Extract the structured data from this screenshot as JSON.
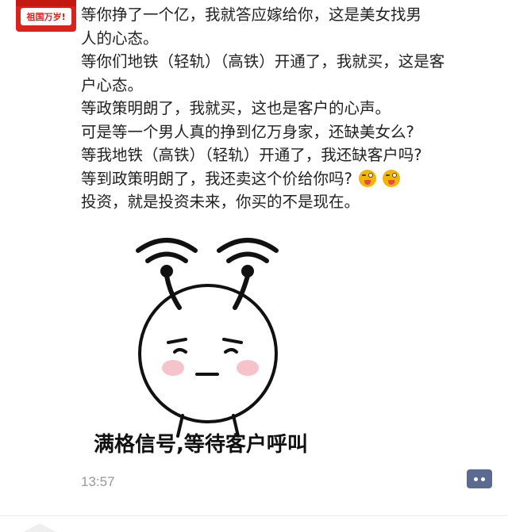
{
  "avatar": {
    "text": "祖国万岁!",
    "bg_color": "#d9241e"
  },
  "post": {
    "lines": [
      "等你挣了一个亿，我就答应嫁给你，这是美女找男",
      "人的心态。",
      "等你们地铁（轻轨）（高铁）开通了，我就买，这是客",
      "户心态。",
      "等政策明朗了，我就买，这也是客户的心声。",
      "可是等一个男人真的挣到亿万身家，还缺美女么?",
      "等我地铁（高铁）（轻轨）开通了，我还缺客户吗?",
      "等到政策明朗了，我还卖这个价给你吗?",
      "投资，就是投资未来，你买的不是现在。"
    ],
    "emoji_icon": "tongue-wink-emoji-icon"
  },
  "meme": {
    "caption": "满格信号,等待客户呼叫",
    "icon": "wifi-antenna-face-icon"
  },
  "timestamp": "13:57",
  "more_button": {
    "icon": "more-dots-icon",
    "color": "#5b6b8f"
  }
}
